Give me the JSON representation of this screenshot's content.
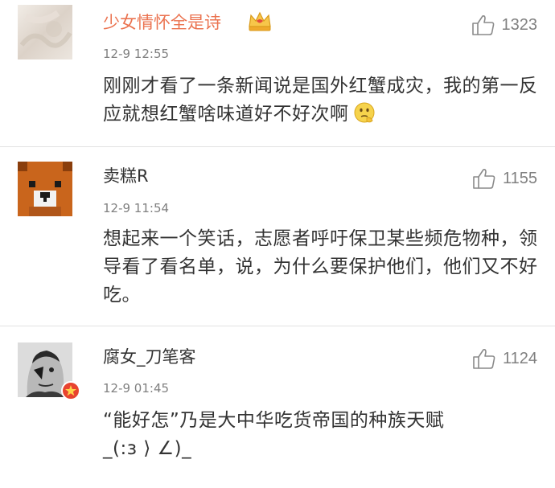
{
  "comments": [
    {
      "username": "少女情怀全是诗",
      "time": "12-9 12:55",
      "likes": "1323",
      "text": "刚刚才看了一条新闻说是国外红蟹成灾，我的第一反应就想红蟹啥味道好不好次啊",
      "avatar_icon": "blurred-photo-avatar",
      "name_badge_icon": "vip-crown-icon",
      "trailing_emoji": "thinking-face-emoji"
    },
    {
      "username": "卖糕R",
      "time": "12-9 11:54",
      "likes": "1155",
      "text": "想起来一个笑话，志愿者呼吁保卫某些频危物种，领导看了看名单，说，为什么要保护他们，他们又不好吃。",
      "avatar_icon": "pixel-bear-avatar"
    },
    {
      "username": "腐女_刀笔客",
      "time": "12-9 01:45",
      "likes": "1124",
      "text_line1": "“能好怎”乃是大中华吃货帝国的种族天赋",
      "text_line2": "_(:з ⟩ ∠)_",
      "avatar_icon": "painted-face-avatar",
      "avatar_badge_icon": "verified-star-badge"
    }
  ],
  "colors": {
    "vip_name": "#eb7350",
    "normal_name": "#333333",
    "meta": "#808080",
    "divider": "#e2e2e2"
  }
}
